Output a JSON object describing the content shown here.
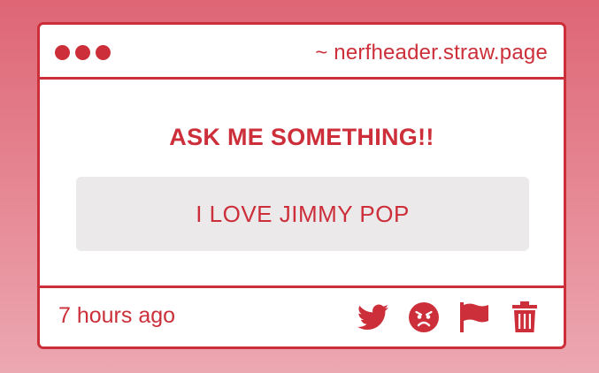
{
  "window": {
    "url": "~ nerfheader.straw.page"
  },
  "main": {
    "question": "ASK ME SOMETHING!!",
    "answer": "I LOVE JIMMY POP"
  },
  "footer": {
    "timestamp": "7 hours ago",
    "actions": [
      {
        "icon": "twitter-icon"
      },
      {
        "icon": "angry-face-icon"
      },
      {
        "icon": "flag-icon"
      },
      {
        "icon": "trash-icon"
      }
    ]
  },
  "colors": {
    "accent": "#cc2f3a",
    "background_top": "#de6675",
    "background_bottom": "#eca8b1",
    "answer_bg": "#ebe9ea"
  }
}
